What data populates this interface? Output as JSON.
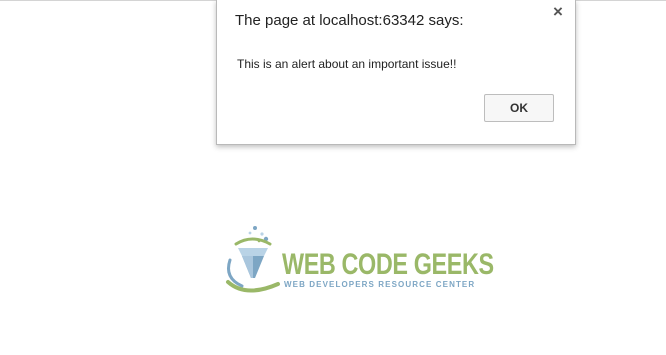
{
  "alert_dialog": {
    "title": "The page at localhost:63342 says:",
    "close_symbol": "×",
    "message": "This is an alert about an important issue!!",
    "ok_label": "OK"
  },
  "logo": {
    "name": "WEB CODE GEEKS",
    "tagline": "WEB DEVELOPERS RESOURCE CENTER",
    "icon": "gem-icon",
    "colors": {
      "green": "#9ab868",
      "blue": "#7da6c4",
      "light_blue": "#b9d3e6"
    }
  }
}
